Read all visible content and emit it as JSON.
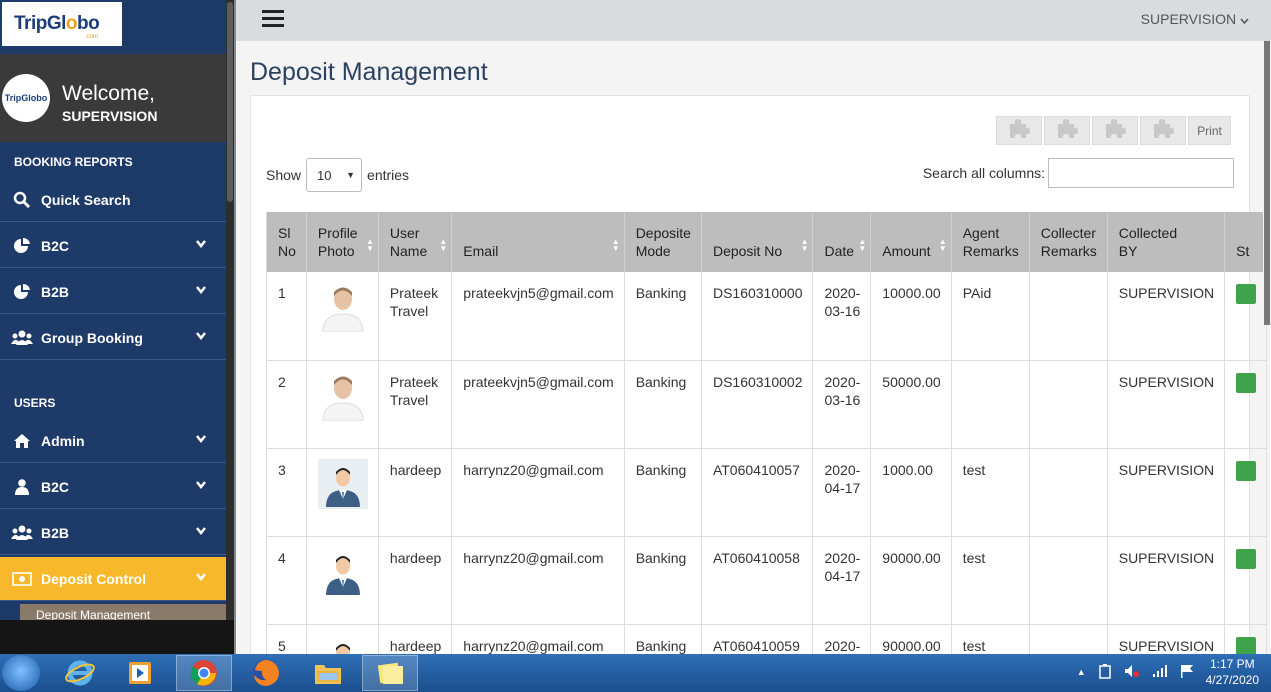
{
  "brand": {
    "logo_text_a": "TripGl",
    "logo_text_o": "o",
    "logo_text_b": "bo",
    "logo_sub": ".com",
    "avatar_text": "TripGlobo"
  },
  "welcome": {
    "title": "Welcome,",
    "user": "SUPERVISION"
  },
  "sidebar": {
    "section_booking": "BOOKING REPORTS",
    "section_users": "USERS",
    "items": [
      {
        "label": "Quick Search",
        "icon": "search-icon"
      },
      {
        "label": "B2C",
        "icon": "pie-chart-icon"
      },
      {
        "label": "B2B",
        "icon": "pie-chart-icon"
      },
      {
        "label": "Group Booking",
        "icon": "users-icon"
      },
      {
        "label": "Admin",
        "icon": "home-icon"
      },
      {
        "label": "B2C",
        "icon": "user-icon"
      },
      {
        "label": "B2B",
        "icon": "users-icon"
      },
      {
        "label": "Deposit Control",
        "icon": "money-icon"
      }
    ],
    "sub_item": "Deposit Management",
    "active_color": "#f7b92b"
  },
  "topbar": {
    "user_menu": "SUPERVISION"
  },
  "page": {
    "title": "Deposit Management"
  },
  "toolbar": {
    "print_label": "Print"
  },
  "table_controls": {
    "show_label": "Show",
    "entries_value": "10",
    "entries_label": "entries",
    "search_label": "Search all columns:"
  },
  "table": {
    "columns": [
      [
        "Sl",
        "No"
      ],
      [
        "Profile",
        "Photo"
      ],
      [
        "User",
        "Name"
      ],
      [
        "Email",
        ""
      ],
      [
        "Deposite",
        "Mode"
      ],
      [
        "Deposit No",
        ""
      ],
      [
        "Date",
        ""
      ],
      [
        "Amount",
        ""
      ],
      [
        "Agent",
        "Remarks"
      ],
      [
        "Collecter",
        "Remarks"
      ],
      [
        "Collected",
        "BY"
      ],
      [
        "St",
        ""
      ]
    ],
    "rows": [
      {
        "sl": "1",
        "user": [
          "Prateek",
          "Travel"
        ],
        "email": "prateekvjn5@gmail.com",
        "mode": "Banking",
        "deposit_no": "DS160310000",
        "date": [
          "2020-",
          "03-16"
        ],
        "amount": "10000.00",
        "agent_remarks": "PAid",
        "collecter_remarks": "",
        "collected_by": "SUPERVISION"
      },
      {
        "sl": "2",
        "user": [
          "Prateek",
          "Travel"
        ],
        "email": "prateekvjn5@gmail.com",
        "mode": "Banking",
        "deposit_no": "DS160310002",
        "date": [
          "2020-",
          "03-16"
        ],
        "amount": "50000.00",
        "agent_remarks": "",
        "collecter_remarks": "",
        "collected_by": "SUPERVISION"
      },
      {
        "sl": "3",
        "user": [
          "hardeep",
          ""
        ],
        "email": "harrynz20@gmail.com",
        "mode": "Banking",
        "deposit_no": "AT060410057",
        "date": [
          "2020-",
          "04-17"
        ],
        "amount": "1000.00",
        "agent_remarks": "test",
        "collecter_remarks": "",
        "collected_by": "SUPERVISION"
      },
      {
        "sl": "4",
        "user": [
          "hardeep",
          ""
        ],
        "email": "harrynz20@gmail.com",
        "mode": "Banking",
        "deposit_no": "AT060410058",
        "date": [
          "2020-",
          "04-17"
        ],
        "amount": "90000.00",
        "agent_remarks": "test",
        "collecter_remarks": "",
        "collected_by": "SUPERVISION"
      },
      {
        "sl": "5",
        "user": [
          "hardeep",
          ""
        ],
        "email": "harrynz20@gmail.com",
        "mode": "Banking",
        "deposit_no": "AT060410059",
        "date": [
          "2020-",
          ""
        ],
        "amount": "90000.00",
        "agent_remarks": "test",
        "collecter_remarks": "",
        "collected_by": "SUPERVISION"
      }
    ]
  },
  "taskbar": {
    "time": "1:17 PM",
    "date": "4/27/2020"
  }
}
